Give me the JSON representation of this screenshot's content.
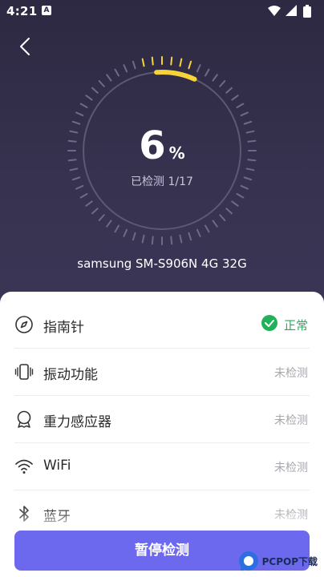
{
  "status_bar": {
    "time": "4:21",
    "notification_icon": "a-icon",
    "icons": [
      "wifi-icon",
      "signal-icon",
      "battery-icon"
    ]
  },
  "header": {
    "back_icon": "chevron-left-icon"
  },
  "scan": {
    "percent": "6",
    "percent_unit": "%",
    "progress_label": "已检测 1/17",
    "device_name": "samsung SM-S906N 4G 32G",
    "progress_fraction": 0.06,
    "accent_color": "#f6d33a"
  },
  "items": [
    {
      "icon": "compass-icon",
      "label": "指南针",
      "status": "正常",
      "status_type": "ok"
    },
    {
      "icon": "vibration-icon",
      "label": "振动功能",
      "status": "未检测",
      "status_type": "pending"
    },
    {
      "icon": "gravity-sensor-icon",
      "label": "重力感应器",
      "status": "未检测",
      "status_type": "pending"
    },
    {
      "icon": "wifi-icon",
      "label": "WiFi",
      "status": "未检测",
      "status_type": "pending"
    },
    {
      "icon": "bluetooth-icon",
      "label": "蓝牙",
      "status": "未检测",
      "status_type": "pending"
    }
  ],
  "footer": {
    "pause_button": "暂停检测"
  },
  "watermark": {
    "text": "PCPOP下载"
  },
  "colors": {
    "background": "#2f2b47",
    "ok": "#21b15a",
    "button": "#6c69ee",
    "pending": "#a7a7ad"
  }
}
